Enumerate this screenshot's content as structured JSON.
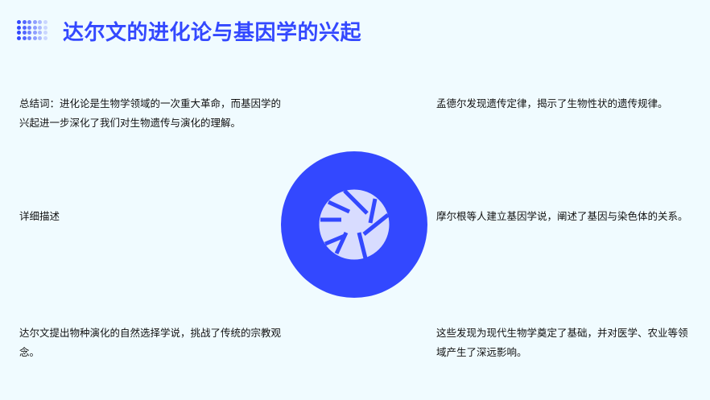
{
  "title": "达尔文的进化论与基因学的兴起",
  "left": {
    "summary": "总结词：进化论是生物学领域的一次重大革命，而基因学的兴起进一步深化了我们对生物遗传与演化的理解。",
    "detail_label": "详细描述",
    "darwin": "达尔文提出物种演化的自然选择学说，挑战了传统的宗教观念。"
  },
  "right": {
    "mendel": "孟德尔发现遗传定律，揭示了生物性状的遗传规律。",
    "morgan": "摩尔根等人建立基因学说，阐述了基因与染色体的关系。",
    "impact": "这些发现为现代生物学奠定了基础，并对医学、农业等领域产生了深远影响。"
  },
  "colors": {
    "accent": "#3348ff",
    "background": "#f0fbff",
    "icon_fill": "#d8dcff"
  },
  "icons": {
    "logo": "dot-grid-icon",
    "center": "aperture-icon"
  }
}
